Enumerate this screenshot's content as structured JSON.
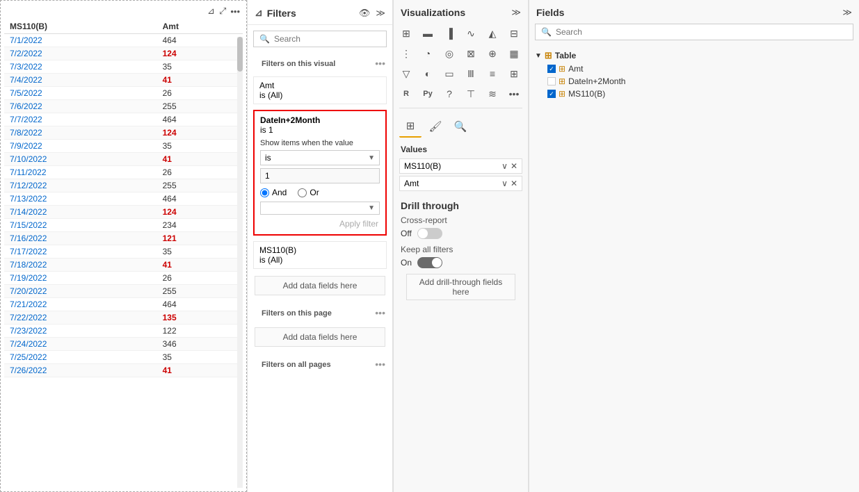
{
  "leftPanel": {
    "columns": [
      "MS110(B)",
      "Amt"
    ],
    "rows": [
      {
        "date": "7/1/2022",
        "amt": "464",
        "highlight": false
      },
      {
        "date": "7/2/2022",
        "amt": "124",
        "highlight": true
      },
      {
        "date": "7/3/2022",
        "amt": "35",
        "highlight": false
      },
      {
        "date": "7/4/2022",
        "amt": "41",
        "highlight": true
      },
      {
        "date": "7/5/2022",
        "amt": "26",
        "highlight": false
      },
      {
        "date": "7/6/2022",
        "amt": "255",
        "highlight": false
      },
      {
        "date": "7/7/2022",
        "amt": "464",
        "highlight": false
      },
      {
        "date": "7/8/2022",
        "amt": "124",
        "highlight": true
      },
      {
        "date": "7/9/2022",
        "amt": "35",
        "highlight": false
      },
      {
        "date": "7/10/2022",
        "amt": "41",
        "highlight": true
      },
      {
        "date": "7/11/2022",
        "amt": "26",
        "highlight": false
      },
      {
        "date": "7/12/2022",
        "amt": "255",
        "highlight": false
      },
      {
        "date": "7/13/2022",
        "amt": "464",
        "highlight": false
      },
      {
        "date": "7/14/2022",
        "amt": "124",
        "highlight": true
      },
      {
        "date": "7/15/2022",
        "amt": "234",
        "highlight": false
      },
      {
        "date": "7/16/2022",
        "amt": "121",
        "highlight": true
      },
      {
        "date": "7/17/2022",
        "amt": "35",
        "highlight": false
      },
      {
        "date": "7/18/2022",
        "amt": "41",
        "highlight": true
      },
      {
        "date": "7/19/2022",
        "amt": "26",
        "highlight": false
      },
      {
        "date": "7/20/2022",
        "amt": "255",
        "highlight": false
      },
      {
        "date": "7/21/2022",
        "amt": "464",
        "highlight": false
      },
      {
        "date": "7/22/2022",
        "amt": "135",
        "highlight": true
      },
      {
        "date": "7/23/2022",
        "amt": "122",
        "highlight": false
      },
      {
        "date": "7/24/2022",
        "amt": "346",
        "highlight": false
      },
      {
        "date": "7/25/2022",
        "amt": "35",
        "highlight": false
      },
      {
        "date": "7/26/2022",
        "amt": "41",
        "highlight": true
      }
    ]
  },
  "filtersPanel": {
    "title": "Filters",
    "searchPlaceholder": "Search",
    "sectionVisualLabel": "Filters on this visual",
    "filterItems": [
      {
        "name": "Amt",
        "value": "is (All)",
        "active": false
      },
      {
        "name": "DateIn+2Month",
        "value": "is 1",
        "active": true,
        "conditionLabel": "Show items when the value",
        "operator": "is",
        "operatorValue": "1",
        "radioAnd": true,
        "radioOr": false
      },
      {
        "name": "MS110(B)",
        "value": "is (All)",
        "active": false
      }
    ],
    "addDataLabel": "Add data fields here",
    "sectionPageLabel": "Filters on this page",
    "addDataPage": "Add data fields here",
    "sectionAllLabel": "Filters on all pages",
    "applyFilterLabel": "Apply filter"
  },
  "visualizationsPanel": {
    "title": "Visualizations",
    "valuesLabel": "Values",
    "valueFields": [
      "MS110(B)",
      "Amt"
    ],
    "drillTitle": "Drill through",
    "crossReportLabel": "Cross-report",
    "crossReportState": "Off",
    "keepFiltersLabel": "Keep all filters",
    "keepFiltersState": "On",
    "addDrillLabel": "Add drill-through fields here"
  },
  "fieldsPanel": {
    "title": "Fields",
    "searchPlaceholder": "Search",
    "tree": {
      "parentName": "Table",
      "children": [
        {
          "name": "Amt",
          "checked": true,
          "type": "measure"
        },
        {
          "name": "DateIn+2Month",
          "checked": false,
          "type": "table"
        },
        {
          "name": "MS110(B)",
          "checked": true,
          "type": "table"
        }
      ]
    }
  }
}
